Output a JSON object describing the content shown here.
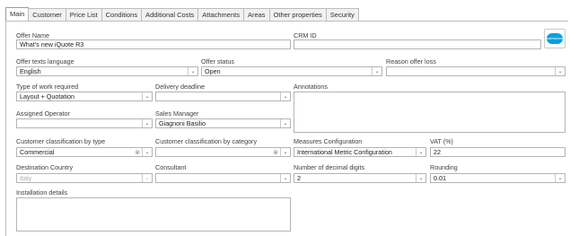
{
  "tabs": [
    "Main",
    "Customer",
    "Price List",
    "Conditions",
    "Additional Costs",
    "Attachments",
    "Areas",
    "Other properties",
    "Security"
  ],
  "fields": {
    "offer_name": {
      "label": "Offer Name",
      "value": "What's new iQuote R3"
    },
    "crm_id": {
      "label": "CRM ID",
      "value": ""
    },
    "offer_texts_language": {
      "label": "Offer texts language",
      "value": "English"
    },
    "offer_status": {
      "label": "Offer status",
      "value": "Open"
    },
    "reason_offer_loss": {
      "label": "Reason offer loss",
      "value": ""
    },
    "type_of_work": {
      "label": "Type of work required",
      "value": "Layout + Quotation"
    },
    "delivery_deadline": {
      "label": "Delivery deadline",
      "value": ""
    },
    "annotations": {
      "label": "Annotations",
      "value": ""
    },
    "assigned_operator": {
      "label": "Assigned Operator",
      "value": ""
    },
    "sales_manager": {
      "label": "Sales Manager",
      "value": "Giagnoni Basilio"
    },
    "customer_class_type": {
      "label": "Customer classification by type",
      "value": "Commercial"
    },
    "customer_class_category": {
      "label": "Customer classification by category",
      "value": ""
    },
    "measures_config": {
      "label": "Measures Configuration",
      "value": "International Metric Configuration"
    },
    "vat": {
      "label": "VAT (%)",
      "value": "22"
    },
    "destination_country": {
      "label": "Destination Country",
      "value": "Italy"
    },
    "consultant": {
      "label": "Consultant",
      "value": ""
    },
    "decimal_digits": {
      "label": "Number of decimal digits",
      "value": "2"
    },
    "rounding": {
      "label": "Rounding",
      "value": "0.01"
    },
    "installation_details": {
      "label": "Installation details",
      "value": ""
    }
  },
  "salesforce_logo_text": "salesforce",
  "icons": {
    "dropdown": "chevron-down-icon",
    "clear": "clear-circle-icon",
    "logo": "salesforce-logo-icon"
  }
}
